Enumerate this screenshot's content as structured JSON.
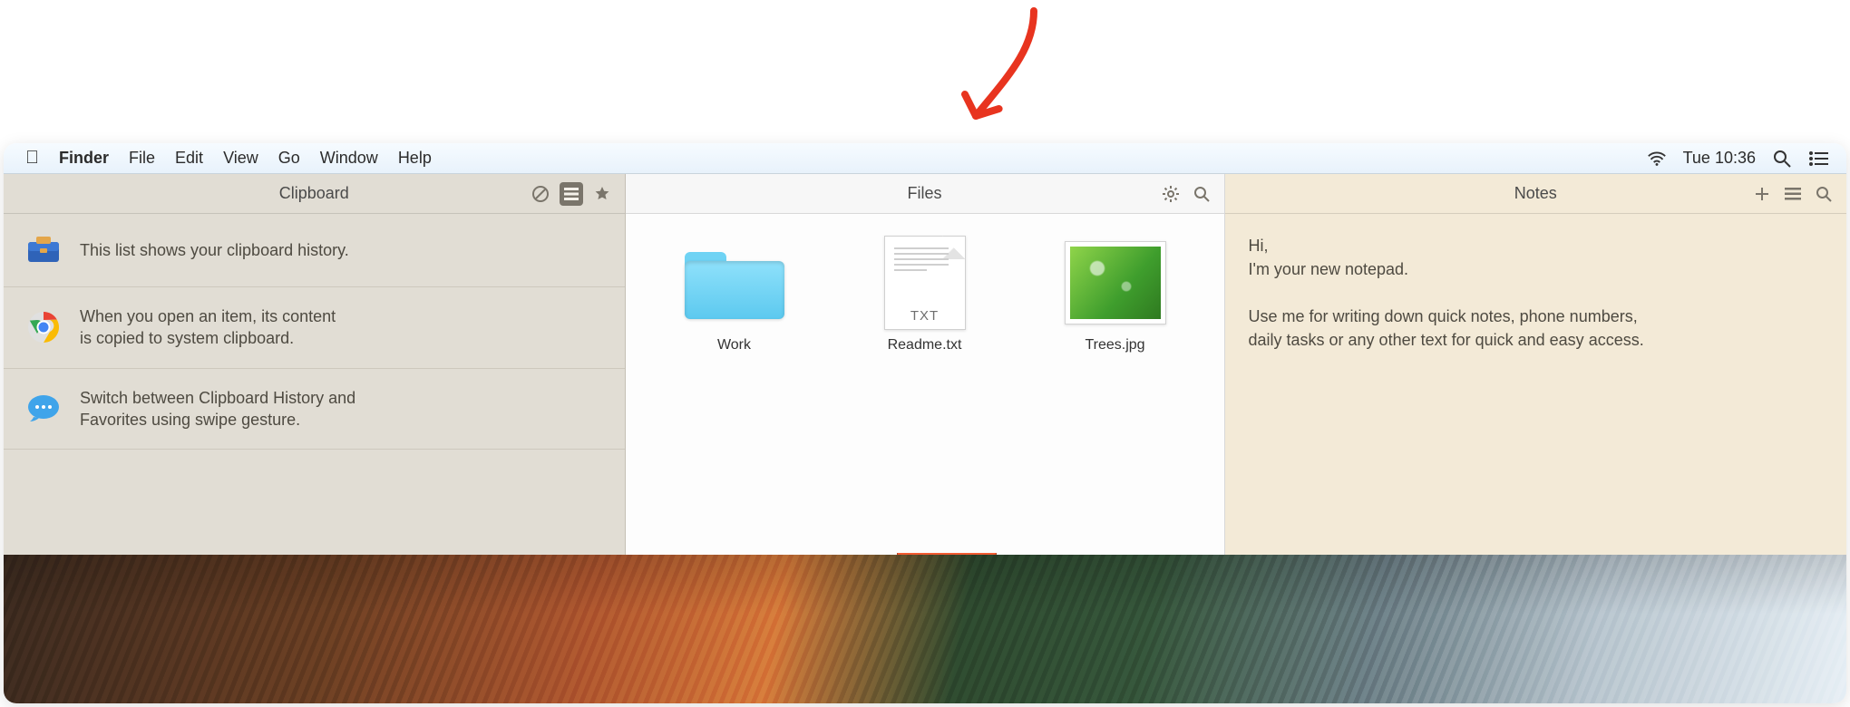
{
  "menubar": {
    "app": "Finder",
    "items": [
      "File",
      "Edit",
      "View",
      "Go",
      "Window",
      "Help"
    ],
    "status_time": "Tue 10:36"
  },
  "clipboard": {
    "title": "Clipboard",
    "items": [
      {
        "icon": "case-icon",
        "text": "This list shows your clipboard history."
      },
      {
        "icon": "chrome-icon",
        "text": "When you open an item, its content\nis copied to system clipboard."
      },
      {
        "icon": "messages-icon",
        "text": "Switch between Clipboard History and\nFavorites using swipe gesture."
      }
    ]
  },
  "files": {
    "title": "Files",
    "items": [
      {
        "kind": "folder",
        "label": "Work"
      },
      {
        "kind": "txt",
        "label": "Readme.txt",
        "ext": "TXT"
      },
      {
        "kind": "image",
        "label": "Trees.jpg"
      }
    ]
  },
  "notes": {
    "title": "Notes",
    "body": "Hi,\nI'm your new notepad.\n\nUse me for writing down quick notes, phone numbers,\ndaily tasks or any other text for quick and easy access."
  }
}
